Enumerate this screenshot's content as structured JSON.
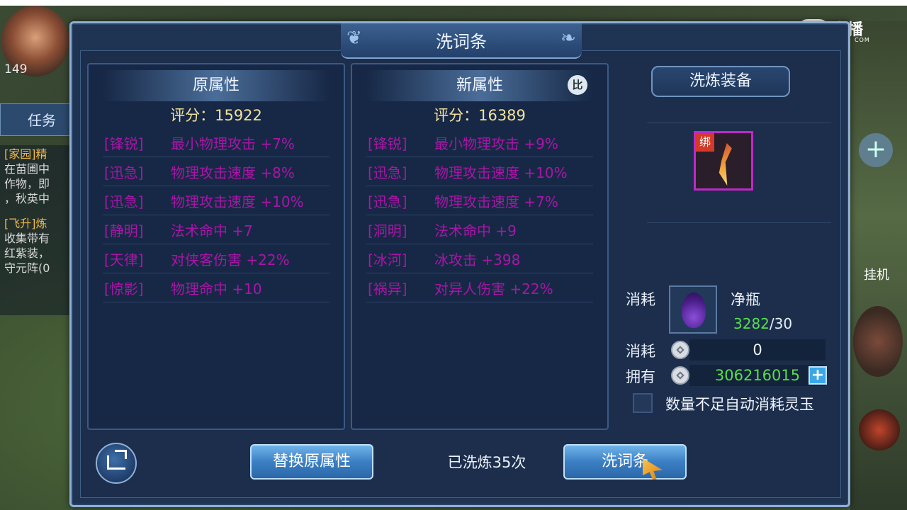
{
  "background": {
    "player_level": "149",
    "task_tab": "任务",
    "quest_lines": [
      "[家园]精",
      "在苗圃中",
      "作物，即",
      "，秋英中",
      "[飞升]炼",
      "收集带有",
      "红紫装，",
      "守元阵(0"
    ],
    "guaji_label": "挂机"
  },
  "watermark": {
    "brand": "直播",
    "sub": "COM"
  },
  "dialog": {
    "title": "洗词条",
    "original": {
      "header": "原属性",
      "score_label": "评分：",
      "score": "15922",
      "attributes": [
        {
          "tag": "[锋锐]",
          "desc": "最小物理攻击 +7%"
        },
        {
          "tag": "[迅急]",
          "desc": "物理攻击速度 +8%"
        },
        {
          "tag": "[迅急]",
          "desc": "物理攻击速度 +10%"
        },
        {
          "tag": "[静明]",
          "desc": "法术命中 +7"
        },
        {
          "tag": "[天律]",
          "desc": "对侠客伤害 +22%"
        },
        {
          "tag": "[惊影]",
          "desc": "物理命中 +10"
        }
      ]
    },
    "new": {
      "header": "新属性",
      "compare_label": "比",
      "score_label": "评分：",
      "score": "16389",
      "attributes": [
        {
          "tag": "[锋锐]",
          "desc": "最小物理攻击 +9%"
        },
        {
          "tag": "[迅急]",
          "desc": "物理攻击速度 +10%"
        },
        {
          "tag": "[迅急]",
          "desc": "物理攻击速度 +7%"
        },
        {
          "tag": "[洞明]",
          "desc": "法术命中 +9"
        },
        {
          "tag": "[冰河]",
          "desc": "冰攻击 +398"
        },
        {
          "tag": "[祸异]",
          "desc": "对异人伤害 +22%"
        }
      ]
    },
    "equipment": {
      "header": "洗炼装备",
      "bind_label": "绑"
    },
    "cost": {
      "item_label": "消耗",
      "item_name": "净瓶",
      "item_have": "3282",
      "item_need": "/30",
      "coin_cost_label": "消耗",
      "coin_cost": "0",
      "own_label": "拥有",
      "own_amount": "306216015",
      "plus": "+",
      "auto_label": "数量不足自动消耗灵玉"
    },
    "bottom": {
      "replace_label": "替换原属性",
      "wash_count": "已洗炼35次",
      "wash_label": "洗词条"
    }
  },
  "colors": {
    "attribute_text": "#a816a6",
    "score_text": "#f3e29a",
    "own_amount": "#56e04a",
    "button": "#3b7fc4"
  }
}
